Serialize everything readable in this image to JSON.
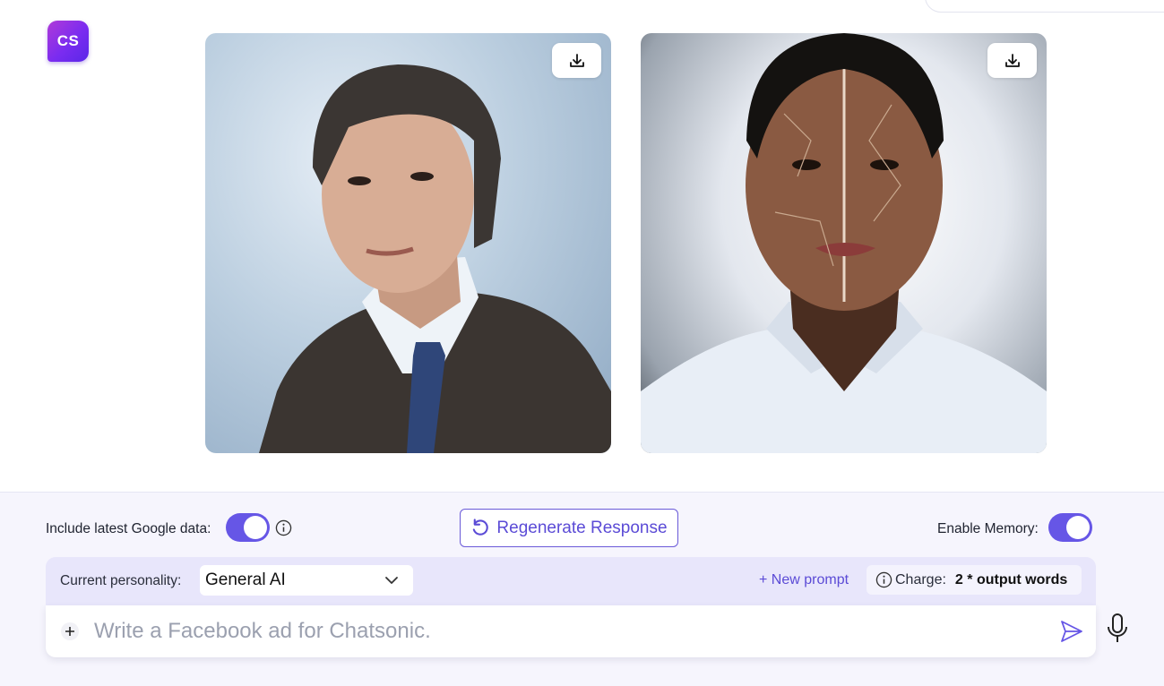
{
  "app": {
    "logo_text": "CS",
    "accent_color": "#6656e6",
    "brand_gradient": [
      "#b03ad8",
      "#5a27e8"
    ]
  },
  "top_toolbar": {
    "icons": [
      "edit-icon",
      "globe-icon",
      "image-icon",
      "keyboard-icon",
      "pin-icon",
      "pencil-icon"
    ]
  },
  "images": [
    {
      "name": "portrait-suit",
      "download_icon": "download-icon"
    },
    {
      "name": "portrait-split-face",
      "download_icon": "download-icon"
    }
  ],
  "controls": {
    "google_label": "Include latest Google data:",
    "google_enabled": true,
    "regenerate_label": "Regenerate Response",
    "memory_label": "Enable Memory:",
    "memory_enabled": true
  },
  "personality": {
    "label": "Current personality:",
    "selected": "General AI",
    "new_prompt": "+ New prompt",
    "charge_label": "Charge:",
    "charge_value": "2 * output words"
  },
  "composer": {
    "placeholder": "Write a Facebook ad for Chatsonic.",
    "value": ""
  }
}
